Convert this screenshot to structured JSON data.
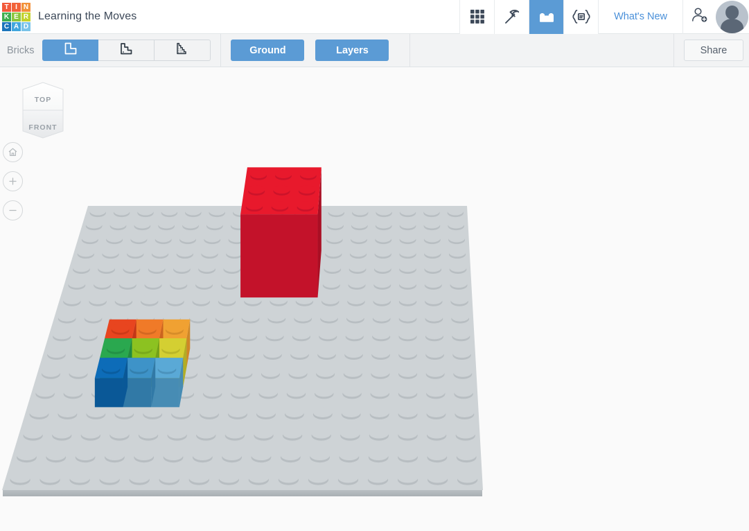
{
  "app": {
    "name": "Tinkercad",
    "logo_tiles": [
      {
        "letter": "T",
        "color": "#f2593a"
      },
      {
        "letter": "I",
        "color": "#f2633a"
      },
      {
        "letter": "N",
        "color": "#f2913a"
      },
      {
        "letter": "K",
        "color": "#3faf50"
      },
      {
        "letter": "E",
        "color": "#8cc63f"
      },
      {
        "letter": "R",
        "color": "#c3d22e"
      },
      {
        "letter": "C",
        "color": "#1b75bb"
      },
      {
        "letter": "A",
        "color": "#41a6dd"
      },
      {
        "letter": "D",
        "color": "#79c3e8"
      }
    ],
    "document_title": "Learning the Moves"
  },
  "header": {
    "mode_tabs": [
      {
        "name": "gallery-grid-icon",
        "label": "Gallery",
        "active": false
      },
      {
        "name": "pickaxe-icon",
        "label": "3D Design",
        "active": false
      },
      {
        "name": "brick-icon",
        "label": "Bricks",
        "active": true
      },
      {
        "name": "codeblocks-icon",
        "label": "Codeblocks",
        "active": false
      }
    ],
    "whats_new": "What's New",
    "add_user": "add-person-icon",
    "avatar": "user-avatar"
  },
  "toolbar": {
    "bricks_label": "Bricks",
    "resolution_options": [
      {
        "label": "Large bricks",
        "active": true
      },
      {
        "label": "Medium bricks",
        "active": false
      },
      {
        "label": "Small bricks",
        "active": false
      }
    ],
    "ground_label": "Ground",
    "layers_label": "Layers",
    "share_label": "Share"
  },
  "canvas": {
    "view_cube": {
      "top_face": "TOP",
      "front_face": "FRONT"
    },
    "nav_buttons": [
      {
        "name": "home-view-button",
        "label": "Home view"
      },
      {
        "name": "zoom-in-button",
        "label": "Zoom in"
      },
      {
        "name": "zoom-out-button",
        "label": "Zoom out"
      }
    ],
    "baseplate": {
      "color": "#ced3d6",
      "edge_color": "#b4babe",
      "stud_shadow": "#b8bec2",
      "cols": 16,
      "rows": 16
    },
    "models": [
      {
        "name": "red-brick-block",
        "grid": "3x3 studs, 3 bricks tall",
        "top_color": "#e8192c",
        "front_color": "#c3122a",
        "side_color": "#aa0f24"
      },
      {
        "name": "rainbow-brick-block",
        "grid": "3x3 studs, 1 brick tall",
        "tiles": [
          {
            "row": 0,
            "col": 0,
            "top": "#e8451f",
            "front": "#c43617"
          },
          {
            "row": 0,
            "col": 1,
            "top": "#f07a28",
            "front": "#cb641f"
          },
          {
            "row": 0,
            "col": 2,
            "top": "#f0a132",
            "front": "#cf8727"
          },
          {
            "row": 1,
            "col": 0,
            "top": "#2aa84f",
            "front": "#208a41"
          },
          {
            "row": 1,
            "col": 1,
            "top": "#8cc221",
            "front": "#73a119"
          },
          {
            "row": 1,
            "col": 2,
            "top": "#d4cf32",
            "front": "#b2ad26"
          },
          {
            "row": 2,
            "col": 0,
            "top": "#0d6cb8",
            "front": "#0a5897"
          },
          {
            "row": 2,
            "col": 1,
            "top": "#3e93c8",
            "front": "#3179a6"
          },
          {
            "row": 2,
            "col": 2,
            "top": "#5aa9d6",
            "front": "#478cb4"
          }
        ]
      }
    ]
  }
}
